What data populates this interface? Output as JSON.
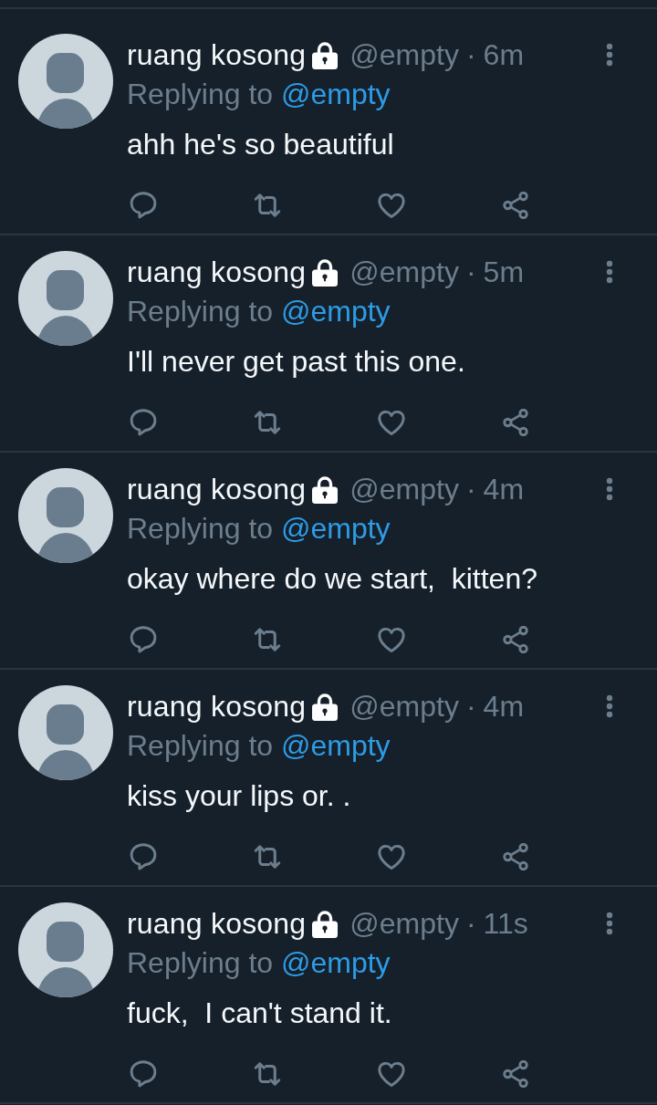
{
  "tweets": [
    {
      "name": "ruang kosong",
      "protected": true,
      "handle": "@empty",
      "separator": "·",
      "time": "6m",
      "replying": {
        "label": "Replying to",
        "handle": "@empty"
      },
      "text": "ahh he's so beautiful"
    },
    {
      "name": "ruang kosong",
      "protected": true,
      "handle": "@empty",
      "separator": "·",
      "time": "5m",
      "replying": {
        "label": "Replying to",
        "handle": "@empty"
      },
      "text": "I'll never get past this one."
    },
    {
      "name": "ruang kosong",
      "protected": true,
      "handle": "@empty",
      "separator": "·",
      "time": "4m",
      "replying": {
        "label": "Replying to",
        "handle": "@empty"
      },
      "text": "okay where do we start,  kitten?"
    },
    {
      "name": "ruang kosong",
      "protected": true,
      "handle": "@empty",
      "separator": "·",
      "time": "4m",
      "replying": {
        "label": "Replying to",
        "handle": "@empty"
      },
      "text": "kiss your lips or. ."
    },
    {
      "name": "ruang kosong",
      "protected": true,
      "handle": "@empty",
      "separator": "·",
      "time": "11s",
      "replying": {
        "label": "Replying to",
        "handle": "@empty"
      },
      "text": "fuck,  I can't stand it."
    }
  ]
}
